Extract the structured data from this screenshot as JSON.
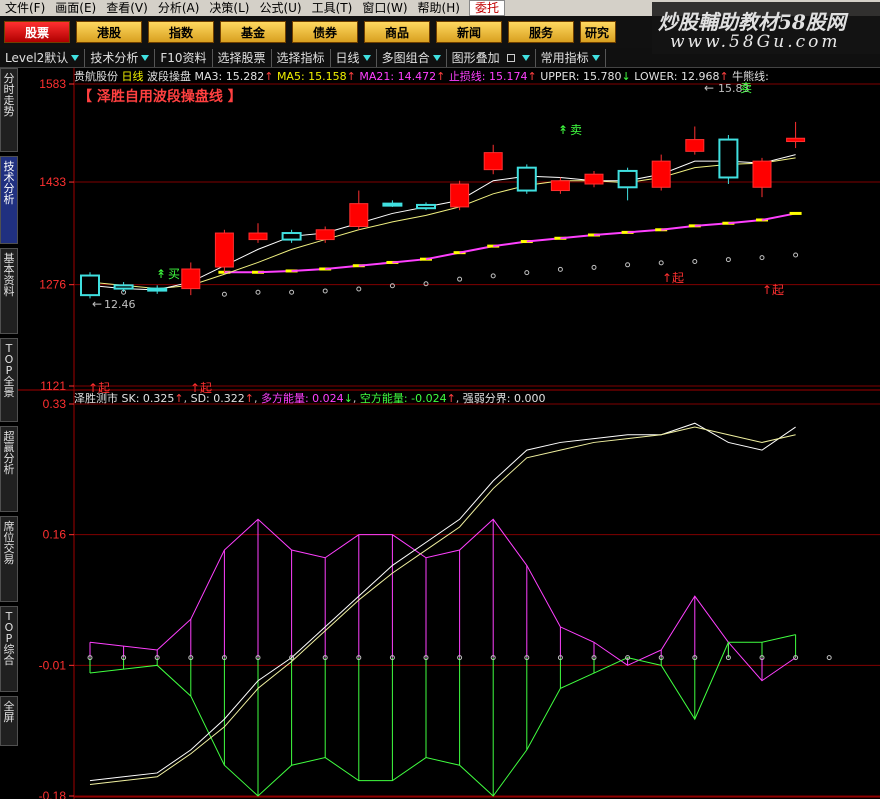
{
  "menu": [
    "文件(F)",
    "画面(E)",
    "查看(V)",
    "分析(A)",
    "决策(L)",
    "公式(U)",
    "工具(T)",
    "窗口(W)",
    "帮助(H)"
  ],
  "menu_entrust": "委托",
  "market_tabs": [
    "股票",
    "港股",
    "指数",
    "基金",
    "债券",
    "商品",
    "新闻",
    "服务",
    "研究"
  ],
  "watermark": {
    "line1": "炒股輔助教材58股网",
    "line2": "www.58Gu.com"
  },
  "toolbar": [
    "Level2默认",
    "技术分析",
    "F10资料",
    "选择股票",
    "选择指标",
    "日线",
    "多图组合",
    "图形叠加",
    "常用指标"
  ],
  "side_tabs": [
    "分时走势",
    "技术分析",
    "基本资料",
    "TOP全景",
    "超赢分析",
    "席位交易",
    "TOP综合",
    "全屏"
  ],
  "main_info": {
    "stock": "贵航股份",
    "period": "日线",
    "indicator": "波段操盘",
    "ma3": "MA3: 15.282",
    "ma5": "MA5: 15.158",
    "ma21": "MA21: 14.472",
    "stop": "止损线: 15.174",
    "upper": "UPPER: 15.780",
    "lower": "LOWER: 12.968",
    "bull": "牛熊线:"
  },
  "main_title": "【  泽胜自用波段操盘线  】",
  "sub_info": {
    "name": "泽胜测市",
    "sk": "SK: 0.325",
    "sd": "SD: 0.322",
    "bull_energy": "多方能量: 0.024",
    "bear_energy": "空方能量: -0.024",
    "divide": "强弱分界: 0.000"
  },
  "signals": {
    "sell": "卖",
    "buy": "买",
    "rise": "起",
    "low_label": "12.46",
    "high_label": "15.83"
  },
  "y_labels_main": [
    "1583",
    "1433",
    "1276",
    "1121"
  ],
  "y_labels_sub": [
    "0.33",
    "0.16",
    "-0.01",
    "-0.18"
  ],
  "colors": {
    "up": "#ff0000",
    "down": "#40e0e0",
    "ma": "#ffffff",
    "bull_line": "#ffff00",
    "bear_line": "#ff40ff",
    "grid": "#800000"
  },
  "chart_data": {
    "type": "candlestick",
    "candles": [
      {
        "o": 12.9,
        "c": 12.6,
        "h": 12.95,
        "l": 12.55
      },
      {
        "o": 12.75,
        "c": 12.7,
        "h": 12.8,
        "l": 12.65
      },
      {
        "o": 12.7,
        "c": 12.67,
        "h": 12.75,
        "l": 12.62
      },
      {
        "o": 12.7,
        "c": 13.0,
        "h": 13.1,
        "l": 12.6
      },
      {
        "o": 13.03,
        "c": 13.55,
        "h": 13.6,
        "l": 12.95
      },
      {
        "o": 13.45,
        "c": 13.55,
        "h": 13.7,
        "l": 13.4
      },
      {
        "o": 13.55,
        "c": 13.45,
        "h": 13.6,
        "l": 13.4
      },
      {
        "o": 13.45,
        "c": 13.6,
        "h": 13.65,
        "l": 13.4
      },
      {
        "o": 13.65,
        "c": 14.0,
        "h": 14.2,
        "l": 13.6
      },
      {
        "o": 14.0,
        "c": 13.98,
        "h": 14.05,
        "l": 13.95
      },
      {
        "o": 13.98,
        "c": 13.93,
        "h": 14.02,
        "l": 13.9
      },
      {
        "o": 13.95,
        "c": 14.3,
        "h": 14.35,
        "l": 13.9
      },
      {
        "o": 14.52,
        "c": 14.78,
        "h": 14.9,
        "l": 14.45
      },
      {
        "o": 14.55,
        "c": 14.2,
        "h": 14.6,
        "l": 14.15
      },
      {
        "o": 14.2,
        "c": 14.35,
        "h": 14.4,
        "l": 14.15
      },
      {
        "o": 14.3,
        "c": 14.45,
        "h": 14.5,
        "l": 14.25
      },
      {
        "o": 14.5,
        "c": 14.25,
        "h": 14.55,
        "l": 14.05
      },
      {
        "o": 14.25,
        "c": 14.65,
        "h": 14.75,
        "l": 14.2
      },
      {
        "o": 14.8,
        "c": 14.98,
        "h": 15.18,
        "l": 14.75
      },
      {
        "o": 14.98,
        "c": 14.4,
        "h": 15.05,
        "l": 14.3
      },
      {
        "o": 14.25,
        "c": 14.65,
        "h": 14.7,
        "l": 14.1
      },
      {
        "o": 14.95,
        "c": 15.0,
        "h": 15.25,
        "l": 14.85
      }
    ],
    "ma3": [
      12.75,
      12.7,
      12.68,
      12.8,
      13.05,
      13.3,
      13.5,
      13.55,
      13.7,
      13.85,
      13.95,
      14.05,
      14.35,
      14.42,
      14.4,
      14.35,
      14.35,
      14.45,
      14.65,
      14.65,
      14.62,
      14.75
    ],
    "ma5": [
      12.8,
      12.75,
      12.7,
      12.75,
      12.92,
      13.1,
      13.3,
      13.45,
      13.6,
      13.72,
      13.82,
      13.95,
      14.15,
      14.28,
      14.35,
      14.35,
      14.32,
      14.4,
      14.55,
      14.6,
      14.62,
      14.7
    ],
    "bull_line": [
      null,
      null,
      null,
      null,
      12.95,
      12.95,
      12.97,
      13.0,
      13.05,
      13.1,
      13.15,
      13.25,
      13.35,
      13.42,
      13.47,
      13.52,
      13.56,
      13.6,
      13.66,
      13.7,
      13.75,
      13.85
    ],
    "support_dots": [
      12.95,
      12.95,
      null,
      null,
      12.92,
      12.95,
      12.95,
      12.97,
      13.0,
      13.05,
      13.08,
      13.15,
      13.2,
      13.25,
      13.3,
      13.33,
      13.37,
      13.4,
      13.42,
      13.45,
      13.48,
      13.52
    ],
    "sub": {
      "sk": [
        -0.16,
        -0.155,
        -0.15,
        -0.12,
        -0.08,
        -0.03,
        0.0,
        0.04,
        0.08,
        0.12,
        0.15,
        0.18,
        0.23,
        0.27,
        0.28,
        0.285,
        0.29,
        0.29,
        0.305,
        0.28,
        0.27,
        0.3
      ],
      "sd": [
        -0.165,
        -0.16,
        -0.155,
        -0.125,
        -0.09,
        -0.04,
        -0.005,
        0.035,
        0.075,
        0.11,
        0.14,
        0.17,
        0.22,
        0.26,
        0.27,
        0.28,
        0.285,
        0.29,
        0.3,
        0.29,
        0.28,
        0.29
      ],
      "bull": [
        0.02,
        0.015,
        0.01,
        0.05,
        0.14,
        0.18,
        0.14,
        0.13,
        0.16,
        0.16,
        0.13,
        0.14,
        0.18,
        0.12,
        0.04,
        0.02,
        -0.01,
        0.01,
        0.08,
        0.02,
        -0.03,
        0.0
      ],
      "bear": [
        -0.02,
        -0.015,
        -0.01,
        -0.05,
        -0.14,
        -0.18,
        -0.14,
        -0.13,
        -0.16,
        -0.16,
        -0.13,
        -0.14,
        -0.18,
        -0.12,
        -0.04,
        -0.02,
        0.0,
        -0.01,
        -0.08,
        0.02,
        0.02,
        0.03
      ]
    },
    "y_range_main": [
      11.21,
      15.83
    ],
    "y_range_sub": [
      -0.18,
      0.33
    ]
  }
}
